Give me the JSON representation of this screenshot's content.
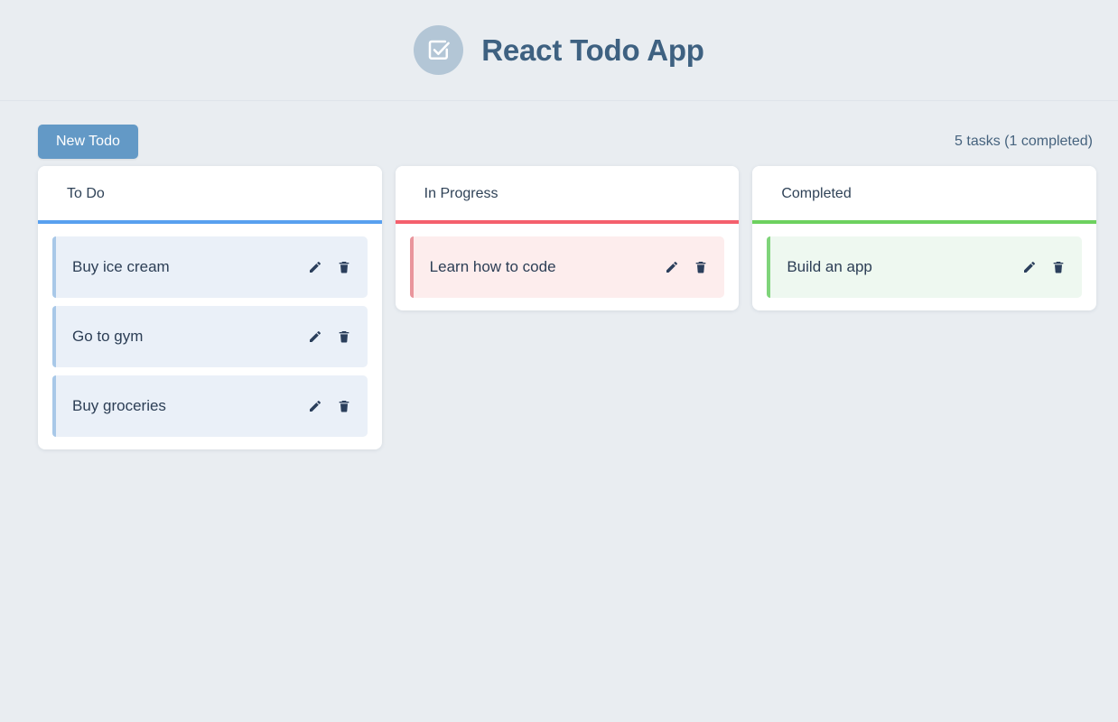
{
  "header": {
    "title": "React Todo App",
    "logo_icon": "check-square-icon",
    "logo_bg": "#b3c6d6",
    "title_color": "#3e6181"
  },
  "toolbar": {
    "new_todo_label": "New Todo",
    "new_todo_color": "#6399c6",
    "task_count_text": "5 tasks (1 completed)"
  },
  "board": {
    "columns": [
      {
        "title": "To Do",
        "accent_color": "#58a0ef",
        "card_bg": "#eaf0f8",
        "card_accent": "#a8c8e8",
        "variant": "todo",
        "tasks": [
          {
            "text": "Buy ice cream",
            "edit_icon": "pencil-icon",
            "delete_icon": "trash-icon"
          },
          {
            "text": "Go to gym",
            "edit_icon": "pencil-icon",
            "delete_icon": "trash-icon"
          },
          {
            "text": "Buy groceries",
            "edit_icon": "pencil-icon",
            "delete_icon": "trash-icon"
          }
        ]
      },
      {
        "title": "In Progress",
        "accent_color": "#f4606d",
        "card_bg": "#fdeded",
        "card_accent": "#e9959c",
        "variant": "inprogress",
        "tasks": [
          {
            "text": "Learn how to code",
            "edit_icon": "pencil-icon",
            "delete_icon": "trash-icon"
          }
        ]
      },
      {
        "title": "Completed",
        "accent_color": "#6dd15f",
        "card_bg": "#eef8f0",
        "card_accent": "#7fd47a",
        "variant": "completed",
        "tasks": [
          {
            "text": "Build an app",
            "edit_icon": "pencil-icon",
            "delete_icon": "trash-icon"
          }
        ]
      }
    ]
  },
  "page": {
    "background": "#e9edf1",
    "text_color": "#2c3e55"
  }
}
